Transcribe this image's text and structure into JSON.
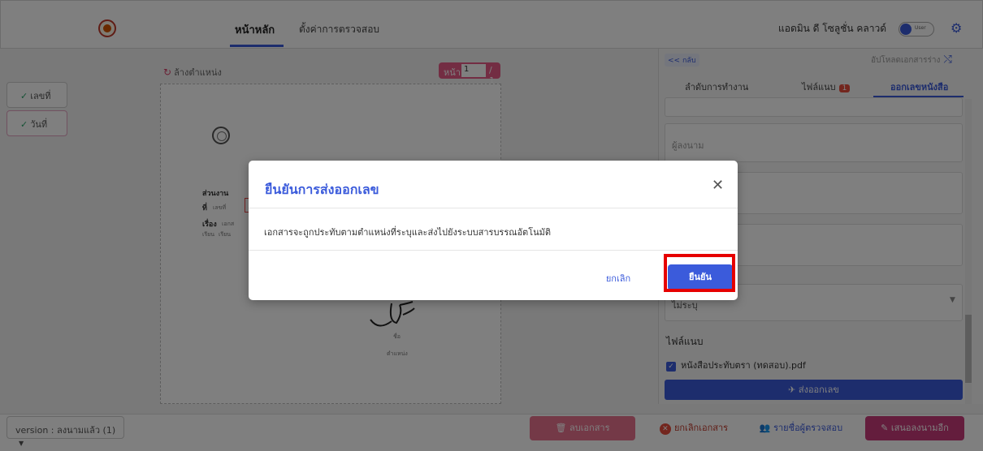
{
  "header": {
    "nav_home": "หน้าหลัก",
    "nav_settings": "ตั้งค่าการตรวจสอบ",
    "user_name": "แอดมิน ดี โซลูชั่น คลาวด์",
    "toggle_label": "User"
  },
  "left": {
    "fields": [
      {
        "label": "เลขที่"
      },
      {
        "label": "วันที่"
      }
    ],
    "reset_position": "ล้างตำแหน่ง",
    "pager": {
      "label": "หน้า :",
      "current": "1",
      "total": "/ 1"
    }
  },
  "document": {
    "line1": "ส่วนงาน",
    "line2_label": "ที่",
    "line2_value": "เลขที่",
    "line3_label": "เรื่อง",
    "line3_value": "เอกส",
    "line4": "เรียน",
    "line4_value": "เรียน",
    "sig_name": "ชื่อ",
    "sig_position": "ตำแหน่ง"
  },
  "right_panel": {
    "back_link": "<< กลับ",
    "upload_draft": "อัปโหลดเอกสารร่าง",
    "tabs": [
      {
        "label": "ลำดับการทำงาน"
      },
      {
        "label": "ไฟล์แนบ",
        "badge": "1"
      },
      {
        "label": "ออกเลขหนังสือ"
      }
    ],
    "signer_placeholder": "ผู้ลงนาม",
    "select_value": "ไม่ระบุ",
    "attachments_heading": "ไฟล์แนบ",
    "attachment_file": "หนังสือประทับตรา (ทดสอบ).pdf",
    "send_button": "ส่งออกเลข"
  },
  "footer": {
    "version": "version : ลงนามแล้ว (1)",
    "delete_doc": "ลบเอกสาร",
    "cancel_doc": "ยกเลิกเอกสาร",
    "reviewers": "รายชื่อผู้ตรวจสอบ",
    "propose_sign": "เสนอลงนามอีก"
  },
  "modal": {
    "title": "ยืนยันการส่งออกเลข",
    "body": "เอกสารจะถูกประทับตามตำแหน่งที่ระบุและส่งไปยังระบบสารบรรณอัตโนมัติ",
    "cancel": "ยกเลิก",
    "confirm": "ยืนยัน"
  },
  "colors": {
    "primary": "#3b5bdb",
    "pink": "#e75a86",
    "highlight": "#e60000"
  }
}
